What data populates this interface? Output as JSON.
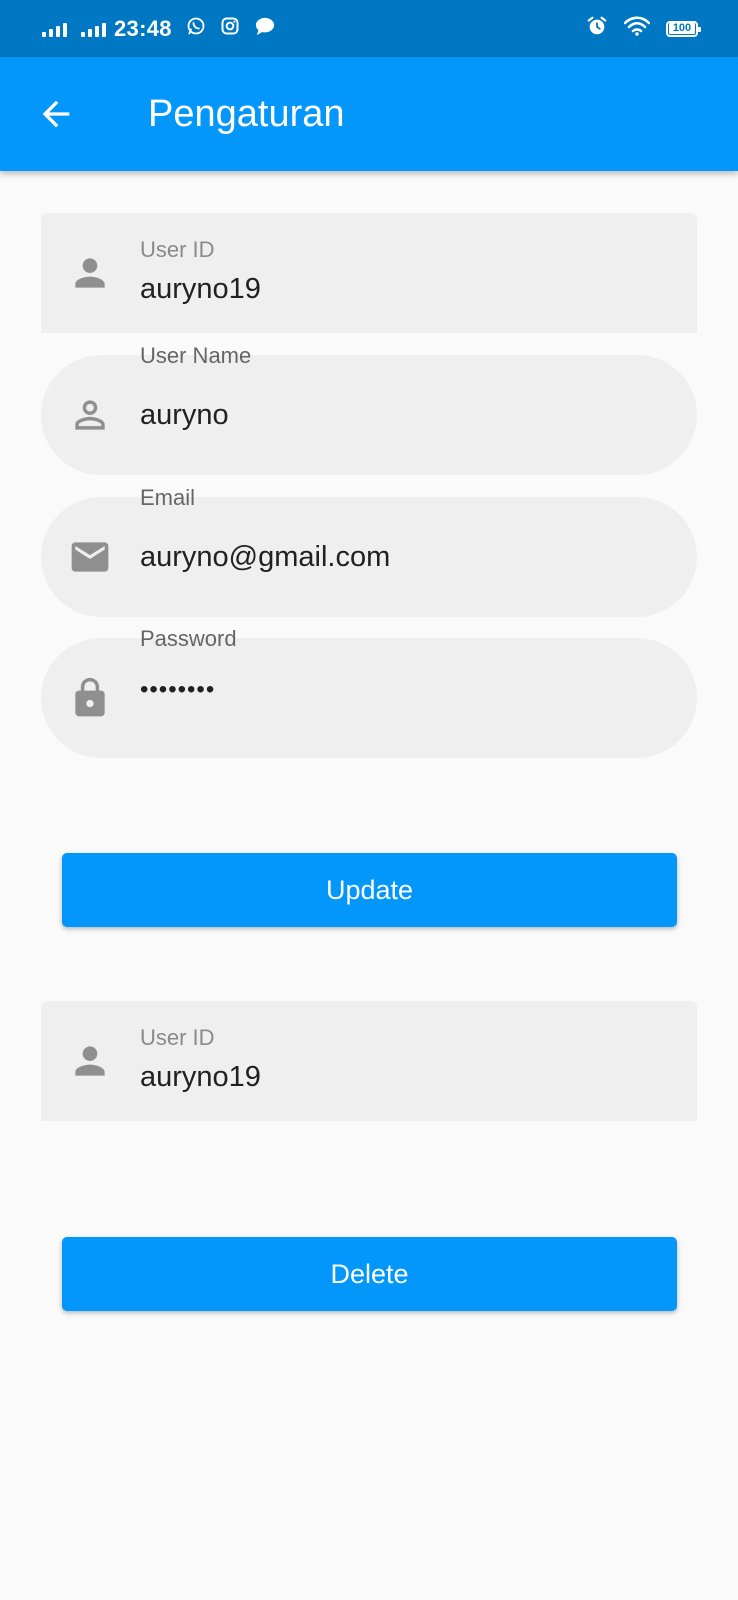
{
  "status_bar": {
    "time": "23:48",
    "battery": "100",
    "icons": [
      "signal-icon",
      "whatsapp-icon",
      "instagram-icon",
      "message-icon",
      "alarm-icon",
      "wifi-icon",
      "battery-icon"
    ]
  },
  "app_bar": {
    "title": "Pengaturan",
    "back_icon": "arrow-back-icon"
  },
  "update_form": {
    "user_id": {
      "label": "User ID",
      "value": "auryno19",
      "icon": "person-icon"
    },
    "user_name": {
      "label": "User Name",
      "value": "auryno",
      "icon": "person-outline-icon"
    },
    "email": {
      "label": "Email",
      "value": "auryno@gmail.com",
      "icon": "mail-icon"
    },
    "password": {
      "label": "Password",
      "value": "••••••••",
      "icon": "lock-icon"
    },
    "submit_label": "Update"
  },
  "delete_form": {
    "user_id": {
      "label": "User ID",
      "value": "auryno19",
      "icon": "person-icon"
    },
    "submit_label": "Delete"
  },
  "colors": {
    "status_bar": "#0077c2",
    "primary": "#0396fb",
    "field_fill": "#efefef",
    "icon_gray": "#8f8f8f",
    "background": "#fafafa"
  }
}
